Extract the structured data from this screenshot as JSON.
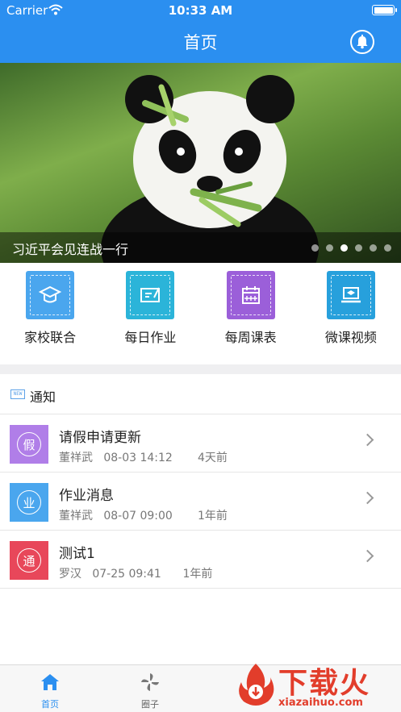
{
  "status_bar": {
    "carrier": "Carrier",
    "time": "10:33 AM"
  },
  "nav": {
    "title": "首页",
    "right_icon": "bell-icon"
  },
  "banner": {
    "caption": "习近平会见连战一行",
    "dot_count": 6,
    "active_dot": 3
  },
  "shortcuts": [
    {
      "label": "家校联合",
      "icon": "graduation-cap-icon",
      "color": "#4aa6ee"
    },
    {
      "label": "每日作业",
      "icon": "edit-card-icon",
      "color": "#2bb4d9"
    },
    {
      "label": "每周课表",
      "icon": "calendar-icon",
      "color": "#9b5fd9"
    },
    {
      "label": "微课视频",
      "icon": "laptop-icon",
      "color": "#27a0dc"
    }
  ],
  "notices": {
    "header_title": "通知",
    "header_icon_text": "NEW",
    "items": [
      {
        "avatar_char": "假",
        "avatar_color": "#b07ee8",
        "title": "请假申请更新",
        "meta": "董祥武   08-03 14:12       4天前"
      },
      {
        "avatar_char": "业",
        "avatar_color": "#4aa6ee",
        "title": "作业消息",
        "meta": "董祥武   08-07 09:00       1年前"
      },
      {
        "avatar_char": "通",
        "avatar_color": "#e8475a",
        "title": "测试1",
        "meta": "罗汉   07-25 09:41      1年前"
      }
    ]
  },
  "tabbar": {
    "tabs": [
      {
        "label": "首页",
        "icon": "home-icon",
        "active": true
      },
      {
        "label": "圈子",
        "icon": "pinwheel-icon",
        "active": false
      }
    ]
  },
  "watermark": {
    "text": "下载火",
    "url": "xiazaihuo.com"
  },
  "colors": {
    "primary": "#2b8ff0"
  }
}
